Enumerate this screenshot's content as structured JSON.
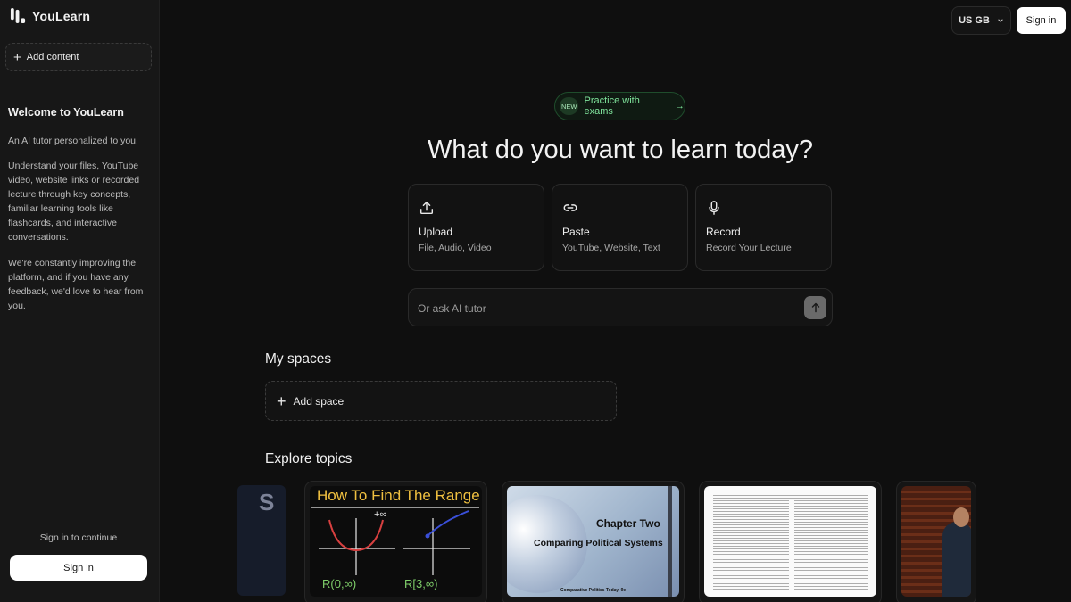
{
  "app": {
    "name": "YouLearn"
  },
  "sidebar": {
    "add_content_label": "Add content",
    "welcome_title": "Welcome to YouLearn",
    "paragraphs": [
      "An AI tutor personalized to you.",
      "Understand your files, YouTube video, website links or recorded lecture through key concepts, familiar learning tools like flashcards, and interactive conversations.",
      "We're constantly improving the platform, and if you have any feedback, we'd love to hear from you."
    ],
    "signin_prompt": "Sign in to continue",
    "signin_button": "Sign in"
  },
  "header": {
    "locale": "US GB",
    "signin_button": "Sign in"
  },
  "hero": {
    "badge_new": "NEW",
    "badge_text": "Practice with exams",
    "badge_arrow": "→",
    "title": "What do you want to learn today?"
  },
  "actions": [
    {
      "title": "Upload",
      "subtitle": "File, Audio, Video",
      "icon": "upload-icon"
    },
    {
      "title": "Paste",
      "subtitle": "YouTube, Website, Text",
      "icon": "link-icon"
    },
    {
      "title": "Record",
      "subtitle": "Record Your Lecture",
      "icon": "microphone-icon"
    }
  ],
  "ask": {
    "placeholder": "Or ask AI tutor"
  },
  "spaces": {
    "title": "My spaces",
    "add_label": "Add space"
  },
  "explore": {
    "title": "Explore topics",
    "topics": [
      {
        "thumb_text": "S"
      },
      {
        "thumb_text": "How To Find The Range",
        "labels": [
          "R(0,∞)",
          "R[3,∞)",
          "+∞"
        ]
      },
      {
        "thumb_text": "Chapter Two",
        "subtitle": "Comparing Political Systems",
        "footer": "Comparative Politics Today, 9e"
      },
      {
        "thumb_text": ""
      },
      {
        "thumb_text": ""
      }
    ]
  },
  "colors": {
    "background": "#0f0f0f",
    "sidebar": "#171717",
    "accent_green": "#7fe39b"
  }
}
